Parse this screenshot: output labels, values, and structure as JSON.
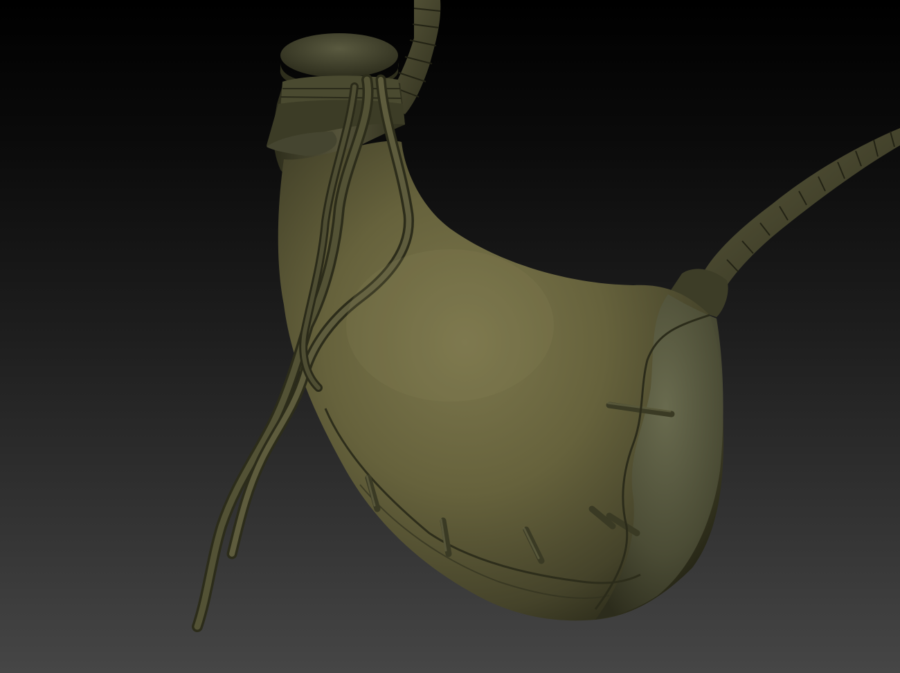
{
  "scene": {
    "colors": {
      "background_top": "#000000",
      "background_bottom": "#464646",
      "leather_light": "#79734a",
      "leather_mid": "#57532f",
      "leather_dark": "#2a2a18",
      "cork": "#3e3e27",
      "strap": "#47472d",
      "side_panel": "#5e6046"
    },
    "icons": [
      "leather-flask-illustration"
    ]
  }
}
